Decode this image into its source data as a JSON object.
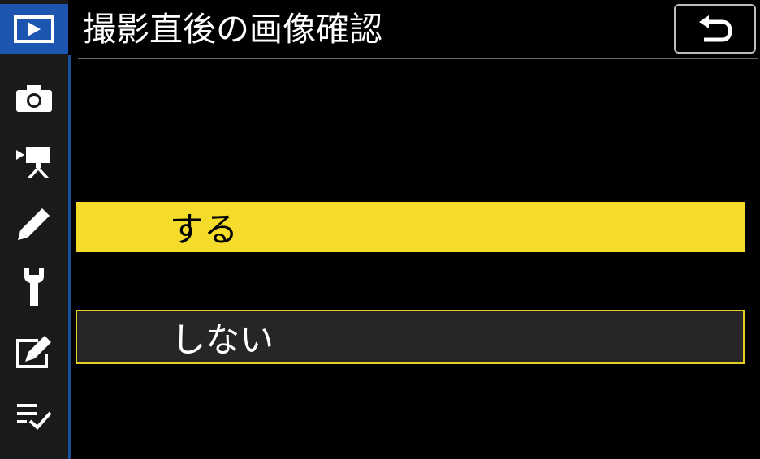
{
  "header": {
    "title": "撮影直後の画像確認",
    "back_icon": "back-arrow-icon"
  },
  "sidebar": {
    "tabs": [
      {
        "icon": "playback-icon",
        "active": true
      },
      {
        "icon": "camera-icon",
        "active": false
      },
      {
        "icon": "movie-camera-icon",
        "active": false
      },
      {
        "icon": "pencil-icon",
        "active": false
      },
      {
        "icon": "wrench-icon",
        "active": false
      },
      {
        "icon": "retouch-icon",
        "active": false
      },
      {
        "icon": "my-menu-icon",
        "active": false
      }
    ]
  },
  "options": [
    {
      "label": "する",
      "selected": true
    },
    {
      "label": "しない",
      "selected": false
    }
  ],
  "colors": {
    "accent_blue": "#1d56b0",
    "highlight_yellow": "#f5dc2a",
    "background": "#000000"
  }
}
